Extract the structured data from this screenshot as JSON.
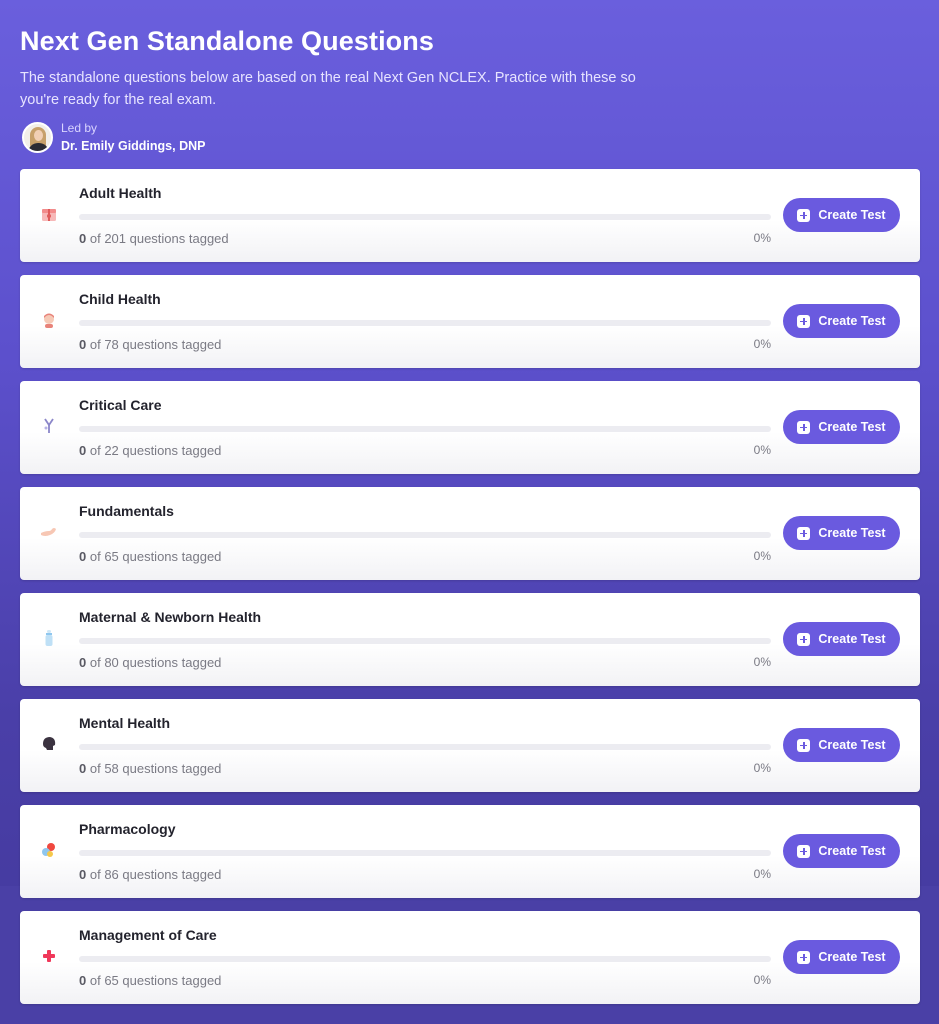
{
  "header": {
    "title": "Next Gen Standalone Questions",
    "description": "The standalone questions below are based on the real Next Gen NCLEX. Practice with these so you're ready for the real exam.",
    "led_by_label": "Led by",
    "leader_name": "Dr. Emily Giddings, DNP"
  },
  "button_label": "Create Test",
  "categories": [
    {
      "name": "Adult Health",
      "tagged": "0",
      "meta_suffix": "of 201 questions tagged",
      "percent": "0%",
      "progress": 0,
      "icon": "gift-icon"
    },
    {
      "name": "Child Health",
      "tagged": "0",
      "meta_suffix": "of 78 questions tagged",
      "percent": "0%",
      "progress": 0,
      "icon": "child-icon"
    },
    {
      "name": "Critical Care",
      "tagged": "0",
      "meta_suffix": "of 22 questions tagged",
      "percent": "0%",
      "progress": 0,
      "icon": "iv-drip-icon"
    },
    {
      "name": "Fundamentals",
      "tagged": "0",
      "meta_suffix": "of 65 questions tagged",
      "percent": "0%",
      "progress": 0,
      "icon": "flexed-arm-icon"
    },
    {
      "name": "Maternal & Newborn Health",
      "tagged": "0",
      "meta_suffix": "of 80 questions tagged",
      "percent": "0%",
      "progress": 0,
      "icon": "baby-bottle-icon"
    },
    {
      "name": "Mental Health",
      "tagged": "0",
      "meta_suffix": "of 58 questions tagged",
      "percent": "0%",
      "progress": 0,
      "icon": "head-icon"
    },
    {
      "name": "Pharmacology",
      "tagged": "0",
      "meta_suffix": "of 86 questions tagged",
      "percent": "0%",
      "progress": 0,
      "icon": "pills-icon"
    },
    {
      "name": "Management of Care",
      "tagged": "0",
      "meta_suffix": "of 65 questions tagged",
      "percent": "0%",
      "progress": 0,
      "icon": "medical-cross-icon"
    }
  ],
  "colors": {
    "accent": "#6a5adf",
    "background_top": "#6a5fdd",
    "background_bottom": "#43399c"
  }
}
